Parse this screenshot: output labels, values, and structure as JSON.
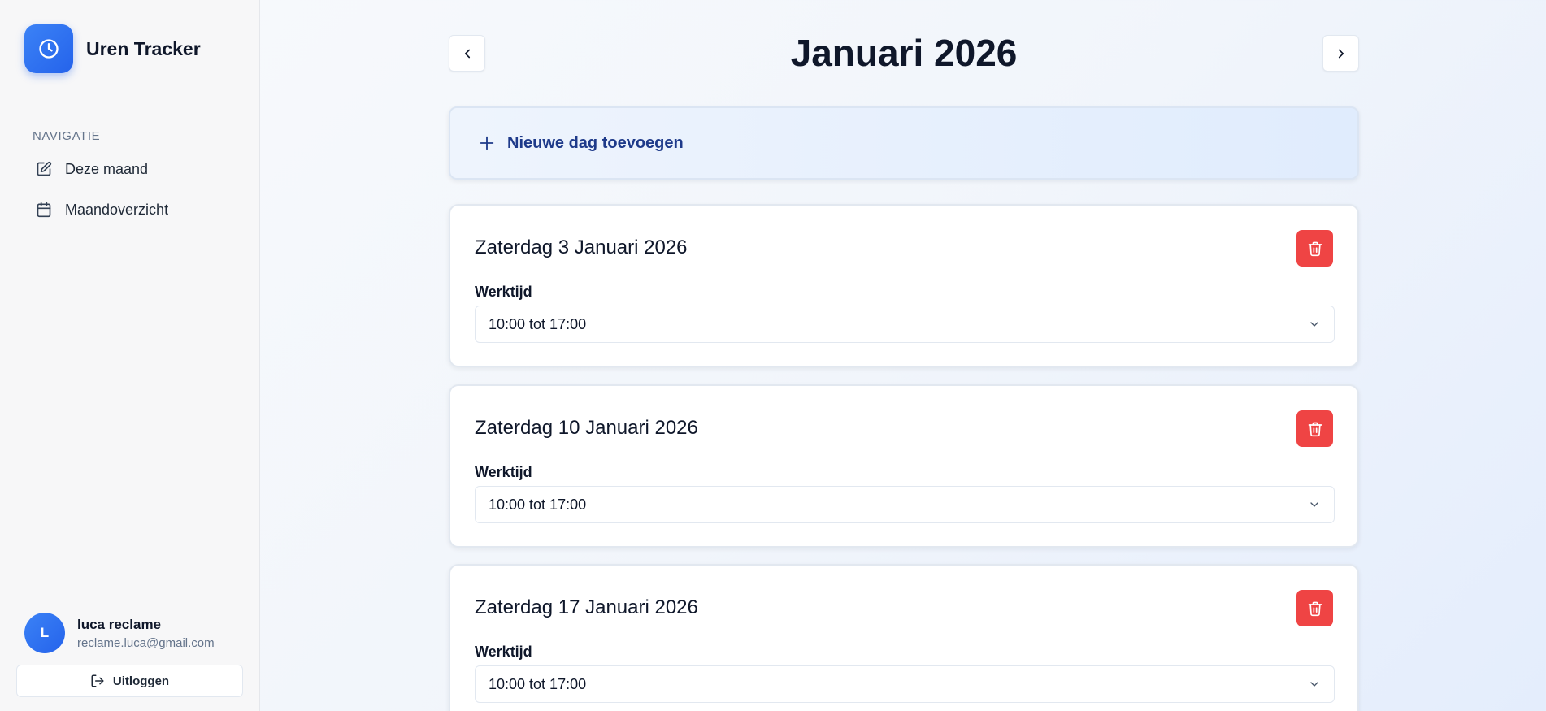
{
  "sidebar": {
    "app_title": "Uren Tracker",
    "nav_heading": "NAVIGATIE",
    "items": [
      {
        "label": "Deze maand",
        "icon": "edit-icon"
      },
      {
        "label": "Maandoverzicht",
        "icon": "calendar-icon"
      }
    ],
    "user": {
      "initial": "L",
      "name": "luca reclame",
      "email": "reclame.luca@gmail.com"
    },
    "logout_label": "Uitloggen"
  },
  "main": {
    "month_title": "Januari 2026",
    "add_day_label": "Nieuwe dag toevoegen",
    "days": [
      {
        "title": "Zaterdag 3 Januari 2026",
        "field_label": "Werktijd",
        "value": "10:00 tot 17:00"
      },
      {
        "title": "Zaterdag 10 Januari 2026",
        "field_label": "Werktijd",
        "value": "10:00 tot 17:00"
      },
      {
        "title": "Zaterdag 17 Januari 2026",
        "field_label": "Werktijd",
        "value": "10:00 tot 17:00"
      }
    ]
  },
  "colors": {
    "accent": "#2563eb",
    "danger": "#ef4444",
    "add_day_text": "#1e3a8a"
  }
}
